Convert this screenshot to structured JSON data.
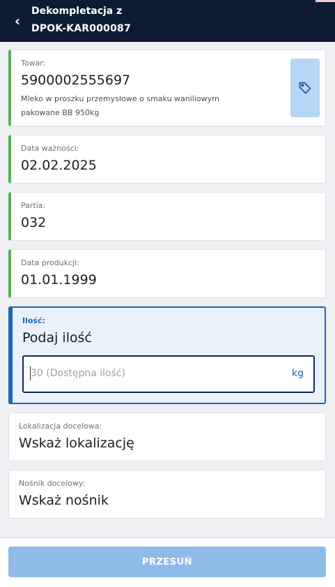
{
  "header": {
    "back_icon": "chevron-left-icon",
    "title_line1": "Dekompletacja z",
    "title_line2": "DPOK-KAR000087"
  },
  "towar": {
    "label": "Towar:",
    "value": "5900002555697",
    "description": "Mleko w proszku przemysłowe o smaku waniliowym pakowane BB 950kg",
    "icon": "tag-icon"
  },
  "data_waznosci": {
    "label": "Data ważności:",
    "value": "02.02.2025"
  },
  "partia": {
    "label": "Partia:",
    "value": "032"
  },
  "data_produkcji": {
    "label": "Data produkcji:",
    "value": "01.01.1999"
  },
  "ilosc": {
    "label": "Ilość:",
    "title": "Podaj ilość",
    "placeholder": "30 (Dostępna ilość)",
    "unit": "kg"
  },
  "lokalizacja": {
    "label": "Lokalizacja docelowa:",
    "value": "Wskaż lokalizację"
  },
  "nosnik": {
    "label": "Nośnik docelowy:",
    "value": "Wskaż nośnik"
  },
  "footer": {
    "submit_label": "PRZESUŃ"
  },
  "colors": {
    "header_bg": "#0d1c33",
    "filled_accent": "#5ab15a",
    "active_accent": "#1d67b8",
    "submit_bg": "#8fbbe8"
  }
}
